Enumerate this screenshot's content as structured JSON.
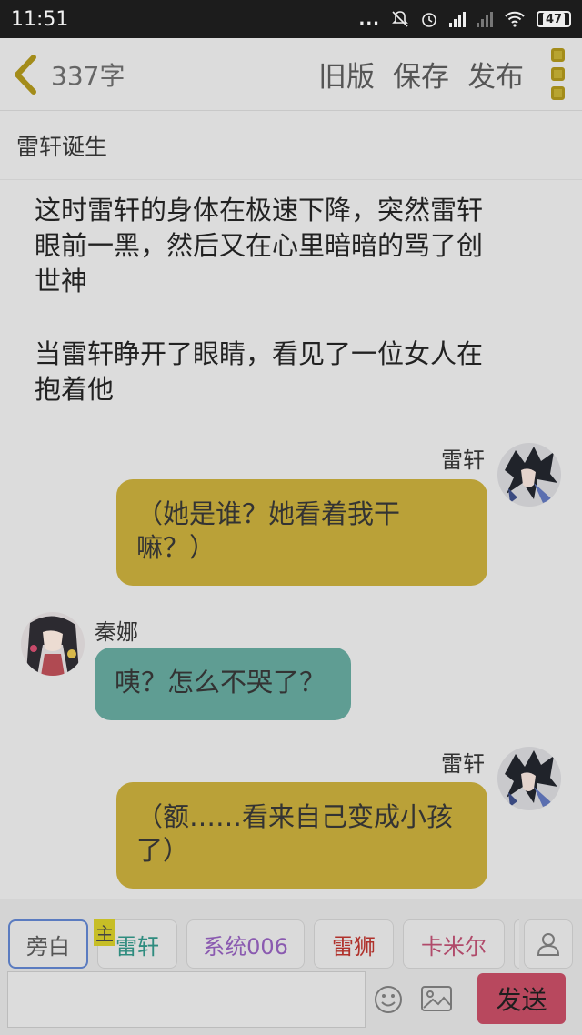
{
  "status_bar": {
    "time": "11:51",
    "dots": "...",
    "battery": "47",
    "icons": [
      "mute-icon",
      "alarm-icon",
      "signal-icon",
      "signal-weak-icon",
      "wifi-icon",
      "battery-icon"
    ]
  },
  "header": {
    "word_count": "337字",
    "actions": [
      "旧版",
      "保存",
      "发布"
    ]
  },
  "chapter_title": "雷轩诞生",
  "messages": [
    {
      "type": "narration",
      "lines": [
        "这时雷轩的身体在极速下降，突然雷轩",
        "眼前一黑，然后又在心里暗暗的骂了创",
        "世神"
      ]
    },
    {
      "type": "narration",
      "lines": [
        "当雷轩睁开了眼睛，看见了一位女人在",
        "抱着他"
      ]
    },
    {
      "type": "right",
      "name": "雷轩",
      "lines": [
        "（她是谁？她看着我干",
        "嘛？）"
      ]
    },
    {
      "type": "left",
      "name": "秦娜",
      "lines": [
        "咦？怎么不哭了？"
      ]
    },
    {
      "type": "right",
      "name": "雷轩",
      "lines": [
        "（额……看来自己变成小孩",
        "了）"
      ]
    }
  ],
  "roles": {
    "main_tag": "主",
    "items": [
      {
        "label": "旁白",
        "color": "#555555"
      },
      {
        "label": "雷轩",
        "color": "#2f8c7f"
      },
      {
        "label": "系统006",
        "color": "#8a5ab0"
      },
      {
        "label": "雷狮",
        "color": "#b0322c"
      },
      {
        "label": "卡米尔",
        "color": "#b04a6a"
      }
    ]
  },
  "input": {
    "placeholder": "",
    "send_label": "发送"
  },
  "colors": {
    "accent_gold": "#b8a430",
    "bubble_yellow": "#baa138",
    "bubble_teal": "#5f9d93",
    "send_button": "#b8485e"
  }
}
